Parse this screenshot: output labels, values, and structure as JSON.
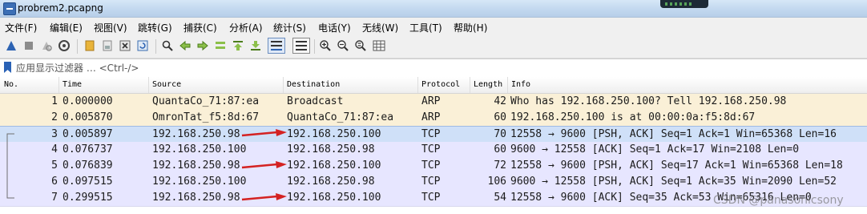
{
  "window": {
    "title": "probrem2.pcapng"
  },
  "menu": [
    "文件(F)",
    "编辑(E)",
    "视图(V)",
    "跳转(G)",
    "捕获(C)",
    "分析(A)",
    "统计(S)",
    "电话(Y)",
    "无线(W)",
    "工具(T)",
    "帮助(H)"
  ],
  "filter": {
    "placeholder": "应用显示过滤器 … <Ctrl-/>"
  },
  "columns": {
    "no": "No.",
    "time": "Time",
    "source": "Source",
    "destination": "Destination",
    "protocol": "Protocol",
    "length": "Length",
    "info": "Info"
  },
  "colors": {
    "arp_row": "#faf0d7",
    "tcp_row": "#e7e6ff",
    "selected_row": "#cfe0f8",
    "arrow": "#d42222"
  },
  "packets": [
    {
      "no": "1",
      "time": "0.000000",
      "source": "QuantaCo_71:87:ea",
      "destination": "Broadcast",
      "protocol": "ARP",
      "length": "42",
      "info": "Who has 192.168.250.100? Tell 192.168.250.98",
      "arrow": false,
      "selected": false
    },
    {
      "no": "2",
      "time": "0.005870",
      "source": "OmronTat_f5:8d:67",
      "destination": "QuantaCo_71:87:ea",
      "protocol": "ARP",
      "length": "60",
      "info": "192.168.250.100 is at 00:00:0a:f5:8d:67",
      "arrow": false,
      "selected": false
    },
    {
      "no": "3",
      "time": "0.005897",
      "source": "192.168.250.98",
      "destination": "192.168.250.100",
      "protocol": "TCP",
      "length": "70",
      "info": "12558 → 9600 [PSH, ACK] Seq=1 Ack=1 Win=65368 Len=16",
      "arrow": true,
      "selected": true
    },
    {
      "no": "4",
      "time": "0.076737",
      "source": "192.168.250.100",
      "destination": "192.168.250.98",
      "protocol": "TCP",
      "length": "60",
      "info": "9600 → 12558 [ACK] Seq=1 Ack=17 Win=2108 Len=0",
      "arrow": false,
      "selected": false
    },
    {
      "no": "5",
      "time": "0.076839",
      "source": "192.168.250.98",
      "destination": "192.168.250.100",
      "protocol": "TCP",
      "length": "72",
      "info": "12558 → 9600 [PSH, ACK] Seq=17 Ack=1 Win=65368 Len=18",
      "arrow": true,
      "selected": false
    },
    {
      "no": "6",
      "time": "0.097515",
      "source": "192.168.250.100",
      "destination": "192.168.250.98",
      "protocol": "TCP",
      "length": "106",
      "info": "9600 → 12558 [PSH, ACK] Seq=1 Ack=35 Win=2090 Len=52",
      "arrow": false,
      "selected": false
    },
    {
      "no": "7",
      "time": "0.299515",
      "source": "192.168.250.98",
      "destination": "192.168.250.100",
      "protocol": "TCP",
      "length": "54",
      "info": "12558 → 9600 [ACK] Seq=35 Ack=53 Win=65316 Len=0",
      "arrow": true,
      "selected": false
    }
  ],
  "watermark": "CSDN @panasonicsony",
  "toolbar_icons": [
    "shark-fin-start-icon",
    "stop-capture-icon",
    "restart-capture-icon",
    "capture-options-icon",
    "open-file-icon",
    "save-file-icon",
    "close-file-icon",
    "reload-file-icon",
    "find-packet-icon",
    "go-back-icon",
    "go-forward-icon",
    "go-to-packet-icon",
    "go-first-icon",
    "go-last-icon",
    "autoscroll-icon",
    "colorize-icon",
    "zoom-in-icon",
    "zoom-out-icon",
    "zoom-normal-icon",
    "resize-columns-icon"
  ]
}
